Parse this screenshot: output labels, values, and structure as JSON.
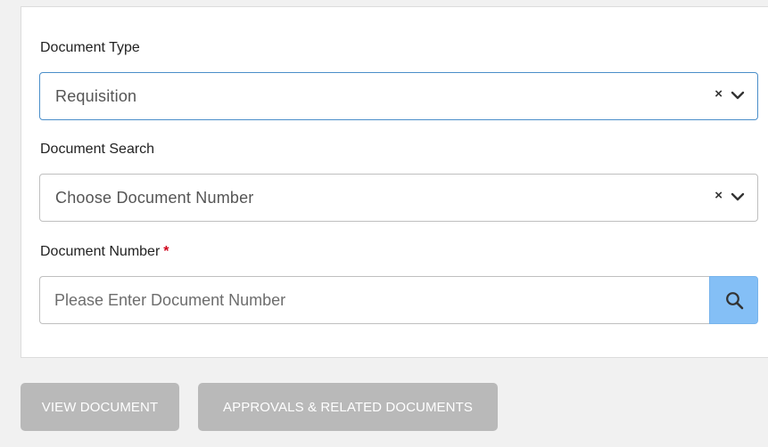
{
  "form": {
    "document_type": {
      "label": "Document Type",
      "value": "Requisition",
      "clear_glyph": "×"
    },
    "document_search": {
      "label": "Document Search",
      "value": "Choose Document Number",
      "clear_glyph": "×"
    },
    "document_number": {
      "label": "Document Number",
      "required_mark": "*",
      "placeholder": "Please Enter Document Number",
      "value": ""
    },
    "search_icon": "magnifier-icon"
  },
  "actions": {
    "view_document": "VIEW DOCUMENT",
    "approvals_related": "APPROVALS & RELATED DOCUMENTS"
  },
  "colors": {
    "focus_border": "#4a8ec9",
    "search_button": "#84bff6",
    "disabled_button": "#b9b9b9",
    "required": "#d0021b"
  }
}
